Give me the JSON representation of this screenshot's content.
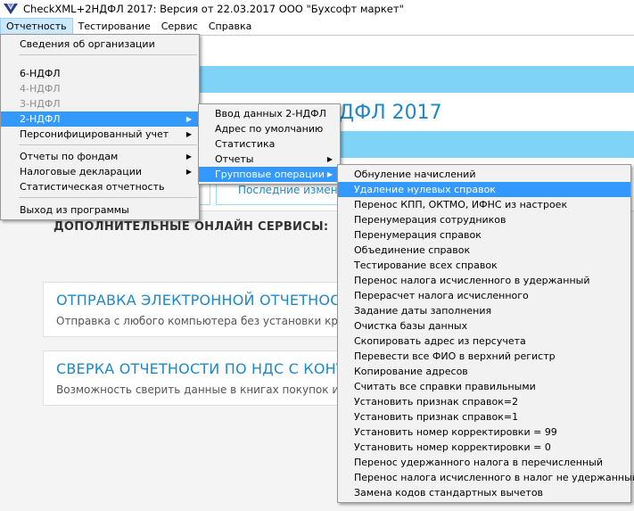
{
  "window": {
    "title": "CheckXML+2НДФЛ 2017:  Версия от 22.03.2017 ООО \"Бухсофт маркет\""
  },
  "menubar": [
    {
      "label": "Отчетность"
    },
    {
      "label": "Тестирование"
    },
    {
      "label": "Сервис"
    },
    {
      "label": "Справка"
    }
  ],
  "background": {
    "big_title": "ДФЛ 2017",
    "tab_label": "Последние измене",
    "services_heading": "ДОПОЛНИТЕЛЬНЫЕ ОНЛАЙН СЕРВИСЫ:",
    "cards": [
      {
        "title": "ОТПРАВКА ЭЛЕКТРОННОЙ ОТЧЕТНОСТИ",
        "desc": "Отправка с любого компьютера без установки кри"
      },
      {
        "title": "СВЕРКА ОТЧЕТНОСТИ ПО НДС С КОНТРА",
        "desc": "Возможность сверить данные в книгах покупок и г"
      }
    ]
  },
  "menu_reports": {
    "items": [
      "Сведения об организации",
      "6-НДФЛ",
      "4-НДФЛ",
      "3-НДФЛ",
      "2-НДФЛ",
      "Персонифицированный учет",
      "Отчеты по фондам",
      "Налоговые декларации",
      "Статистическая отчетность",
      "Выход из программы"
    ]
  },
  "menu_2ndfl": {
    "items": [
      "Ввод данных 2-НДФЛ",
      "Адрес по умолчанию",
      "Статистика",
      "Отчеты",
      "Групповые операции"
    ]
  },
  "menu_group_ops": {
    "items": [
      "Обнуление начислений",
      "Удаление нулевых справок",
      "Перенос КПП, ОКТМО, ИФНС из настроек",
      "Перенумерация сотрудников",
      "Перенумерация справок",
      "Объединение справок",
      "Тестирование всех справок",
      "Перенос налога исчисленного в удержанный",
      "Перерасчет налога исчисленного",
      "Задание даты заполнения",
      "Очистка базы данных",
      "Скопировать адрес из персучета",
      "Перевести все ФИО в верхний регистр",
      "Копирование адресов",
      "Считать все справки правильными",
      "Установить признак справок=2",
      "Установить признак справок=1",
      "Установить номер корректировки = 99",
      "Установить номер корректировки = 0",
      "Перенос удержанного налога в перечисленный",
      "Перенос налога исчисленного в налог не удержанный",
      "Замена кодов стандартных вычетов"
    ]
  },
  "colors": {
    "highlight": "#3399ff",
    "accent": "#1e88c8",
    "band": "#7fd3f7"
  }
}
